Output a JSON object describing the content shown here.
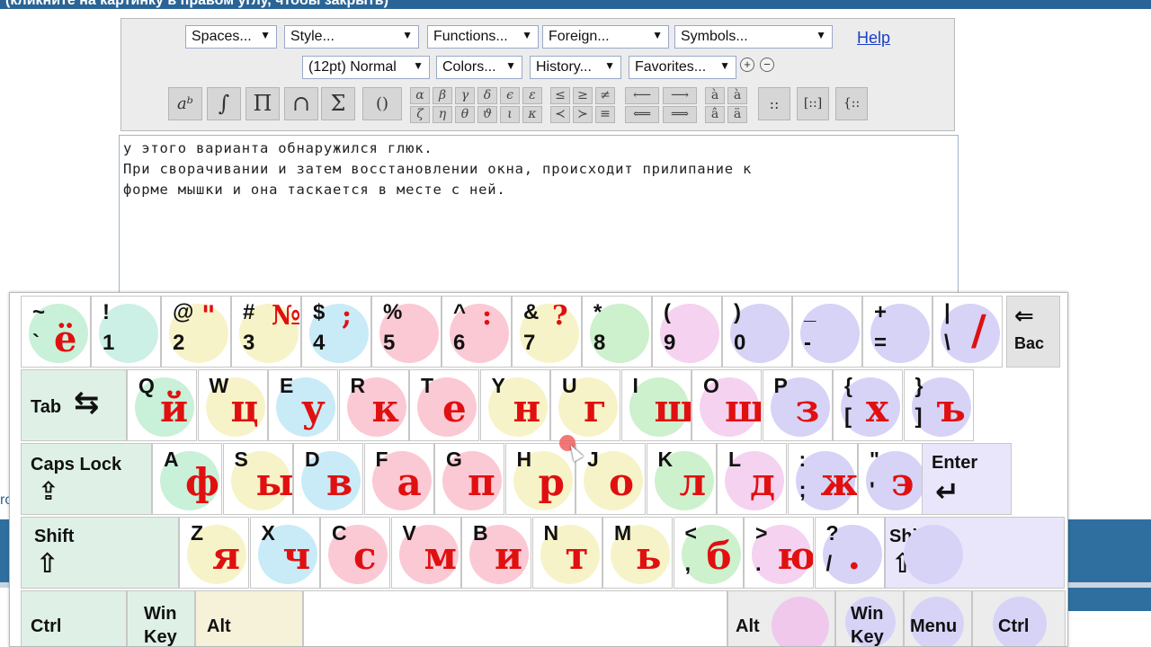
{
  "header": {
    "title_text": "(кликните на картинку в правом углу, чтобы закрыть)"
  },
  "page": {
    "left_fragment": "ro"
  },
  "toolbar": {
    "row1": [
      {
        "label": "Spaces...",
        "arrow": "▼"
      },
      {
        "label": "Style...",
        "arrow": "▼"
      },
      {
        "label": "Functions...",
        "arrow": "▼"
      },
      {
        "label": "Foreign...",
        "arrow": "▼"
      },
      {
        "label": "Symbols...",
        "arrow": "▼"
      }
    ],
    "help": "Help",
    "row2": [
      {
        "label": "(12pt) Normal",
        "arrow": "▼"
      },
      {
        "label": "Colors...",
        "arrow": "▼"
      },
      {
        "label": "History...",
        "arrow": "▼"
      },
      {
        "label": "Favorites...",
        "arrow": "▼"
      }
    ],
    "zoom_in": "+",
    "zoom_out": "−",
    "math_buttons": [
      "aᵇ",
      "∫",
      "Π",
      "∩",
      "Σ",
      "()"
    ],
    "greek_top": [
      "α",
      "β",
      "γ",
      "δ",
      "ϵ",
      "ε"
    ],
    "greek_bottom": [
      "ζ",
      "η",
      "θ",
      "ϑ",
      "ι",
      "κ"
    ],
    "rel_top": [
      "≤",
      "≥",
      "≠"
    ],
    "rel_bottom": [
      "≺",
      "≻",
      "≡"
    ],
    "arrows_top": [
      "⟵",
      "⟶"
    ],
    "arrows_bottom": [
      "⟸",
      "⟹"
    ],
    "accent_top": [
      "à",
      "à"
    ],
    "accent_bottom": [
      "â",
      "ä"
    ],
    "matrix_buttons": [
      "::",
      "[::]",
      "{::"
    ]
  },
  "editor_text": {
    "line1": "у этого варианта обнаружился глюк.",
    "line2": "При сворачивании и затем восстановлении окна, происходит прилипание к",
    "line3": "форме мышки и она таскается в месте с ней."
  },
  "keyboard": {
    "row1": [
      {
        "s1": "~",
        "s2": "`",
        "ru": "ё",
        "color": "#c9f0d8"
      },
      {
        "s1": "!",
        "s2": "1",
        "ru": "",
        "color": "#cdf0e6"
      },
      {
        "s1": "@",
        "s2": "2",
        "ru": "\"",
        "color": "#f7f3c8"
      },
      {
        "s1": "#",
        "s2": "3",
        "ru": "№",
        "color": "#f7f3c8"
      },
      {
        "s1": "$",
        "s2": "4",
        "ru": ";",
        "color": "#c8ebf7"
      },
      {
        "s1": "%",
        "s2": "5",
        "ru": "",
        "color": "#fbc9d4"
      },
      {
        "s1": "^",
        "s2": "6",
        "ru": ":",
        "color": "#fbc9d4"
      },
      {
        "s1": "&",
        "s2": "7",
        "ru": "?",
        "color": "#f7f3c8"
      },
      {
        "s1": "*",
        "s2": "8",
        "ru": "",
        "color": "#cdf0cd"
      },
      {
        "s1": "(",
        "s2": "9",
        "ru": "",
        "color": "#f5d2f0"
      },
      {
        "s1": ")",
        "s2": "0",
        "ru": "",
        "color": "#d6d3f7"
      },
      {
        "s1": "_",
        "s2": "-",
        "ru": "",
        "color": "#d6d3f7"
      },
      {
        "s1": "+",
        "s2": "=",
        "ru": "",
        "color": "#d6d3f7"
      },
      {
        "s1": "|",
        "s2": "\\",
        "ru": "/",
        "color": "#d6d3f7"
      }
    ],
    "backspace": "Bac",
    "tab": "Tab",
    "row2": [
      {
        "en": "Q",
        "ru": "й",
        "color": "#c9f0d8"
      },
      {
        "en": "W",
        "ru": "ц",
        "color": "#f7f3c8"
      },
      {
        "en": "E",
        "ru": "у",
        "color": "#c8ebf7"
      },
      {
        "en": "R",
        "ru": "к",
        "color": "#fbc9d4"
      },
      {
        "en": "T",
        "ru": "е",
        "color": "#fbc9d4"
      },
      {
        "en": "Y",
        "ru": "н",
        "color": "#f7f3c8"
      },
      {
        "en": "U",
        "ru": "г",
        "color": "#f7f3c8"
      },
      {
        "en": "I",
        "ru": "ш",
        "color": "#cdf0cd"
      },
      {
        "en": "O",
        "ru": "щ",
        "color": "#f5d2f0"
      },
      {
        "en": "P",
        "ru": "з",
        "color": "#d6d3f7"
      },
      {
        "en": "{",
        "en2": "[",
        "ru": "х",
        "color": "#d6d3f7"
      },
      {
        "en": "}",
        "en2": "]",
        "ru": "ъ",
        "color": "#d6d3f7"
      }
    ],
    "capslock": "Caps Lock",
    "row3": [
      {
        "en": "A",
        "ru": "ф",
        "color": "#c9f0d8"
      },
      {
        "en": "S",
        "ru": "ы",
        "color": "#f7f3c8"
      },
      {
        "en": "D",
        "ru": "в",
        "color": "#c8ebf7"
      },
      {
        "en": "F",
        "ru": "а",
        "color": "#fbc9d4"
      },
      {
        "en": "G",
        "ru": "п",
        "color": "#fbc9d4"
      },
      {
        "en": "H",
        "ru": "р",
        "color": "#f7f3c8"
      },
      {
        "en": "J",
        "ru": "о",
        "color": "#f7f3c8"
      },
      {
        "en": "K",
        "ru": "л",
        "color": "#cdf0cd"
      },
      {
        "en": "L",
        "ru": "д",
        "color": "#f5d2f0"
      },
      {
        "en": ":",
        "en2": ";",
        "ru": "ж",
        "color": "#d6d3f7"
      },
      {
        "en": "\"",
        "en2": "'",
        "ru": "э",
        "color": "#d6d3f7"
      }
    ],
    "enter": "Enter",
    "shift": "Shift",
    "row4": [
      {
        "en": "Z",
        "ru": "я",
        "color": "#f7f3c8"
      },
      {
        "en": "X",
        "ru": "ч",
        "color": "#c8ebf7"
      },
      {
        "en": "C",
        "ru": "с",
        "color": "#fbc9d4"
      },
      {
        "en": "V",
        "ru": "м",
        "color": "#fbc9d4"
      },
      {
        "en": "B",
        "ru": "и",
        "color": "#fbc9d4"
      },
      {
        "en": "N",
        "ru": "т",
        "color": "#f7f3c8"
      },
      {
        "en": "M",
        "ru": "ь",
        "color": "#f7f3c8"
      },
      {
        "en": "<",
        "en2": ",",
        "ru": "б",
        "color": "#cdf0cd"
      },
      {
        "en": ">",
        "en2": ".",
        "ru": "ю",
        "color": "#f5d2f0"
      },
      {
        "en": "?",
        "en2": "/",
        "ru": ".",
        "color": "#d6d3f7"
      }
    ],
    "ctrl": "Ctrl",
    "win": "Win Key",
    "win_line1": "Win",
    "win_line2": "Key",
    "alt": "Alt",
    "menu": "Menu"
  }
}
